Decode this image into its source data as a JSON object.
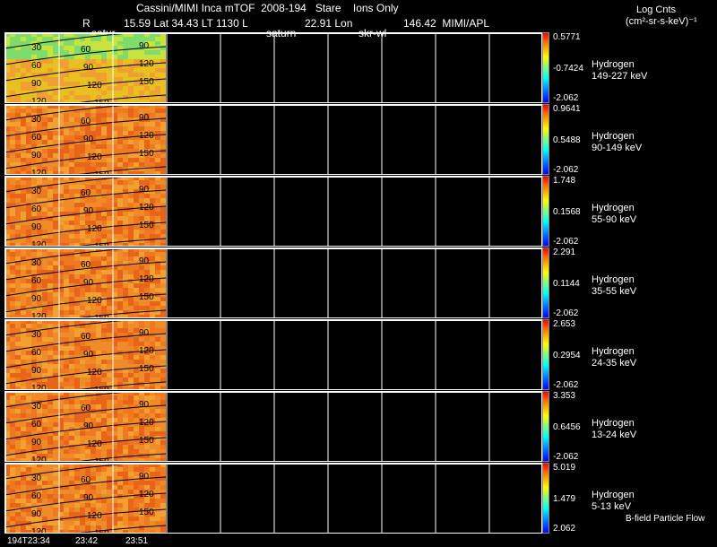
{
  "header": {
    "title": "Cassini/MIMI Inca mTOF  2008-194   Stare    Ions Only",
    "line2_left": "R",
    "line2_mid": "15.59 Lat 34.43 LT 1130 L",
    "line2_lon_value": "22.91 Lon",
    "line2_right": "146.42  MIMI/APL",
    "label_satur": "satur",
    "label_saturn": "saturn",
    "label_skr": "skr-wl",
    "units_title": "Log Cnts",
    "units": "(cm²-sr-s-keV)⁻¹"
  },
  "chart_data": {
    "type": "heatmap",
    "panels": [
      {
        "species": "Hydrogen",
        "energy": "149-227 keV",
        "cmax": "0.5771",
        "cmid": "-0.7424",
        "cmin": "-2.062"
      },
      {
        "species": "Hydrogen",
        "energy": "90-149 keV",
        "cmax": "0.9641",
        "cmid": "0.5488",
        "cmin": "-2.062"
      },
      {
        "species": "Hydrogen",
        "energy": "55-90 keV",
        "cmax": "1.748",
        "cmid": "0.1568",
        "cmin": "-2.062"
      },
      {
        "species": "Hydrogen",
        "energy": "35-55 keV",
        "cmax": "2.291",
        "cmid": "0.1144",
        "cmin": "-2.062"
      },
      {
        "species": "Hydrogen",
        "energy": "24-35 keV",
        "cmax": "2.653",
        "cmid": "0.2954",
        "cmin": "-2.062"
      },
      {
        "species": "Hydrogen",
        "energy": "13-24 keV",
        "cmax": "3.353",
        "cmid": "0.6456",
        "cmin": "-2.062"
      },
      {
        "species": "Hydrogen",
        "energy": "5-13 keV",
        "cmax": "5.019",
        "cmid": "1.479",
        "cmin": "2.062"
      }
    ],
    "contour_labels": [
      "30",
      "60",
      "90",
      "120",
      "60",
      "90",
      "120",
      "150",
      "90",
      "120",
      "150"
    ],
    "x_ticks": [
      "194T23:34",
      "23:42",
      "23:51"
    ],
    "footer_note": "B-field Particle Flow"
  }
}
